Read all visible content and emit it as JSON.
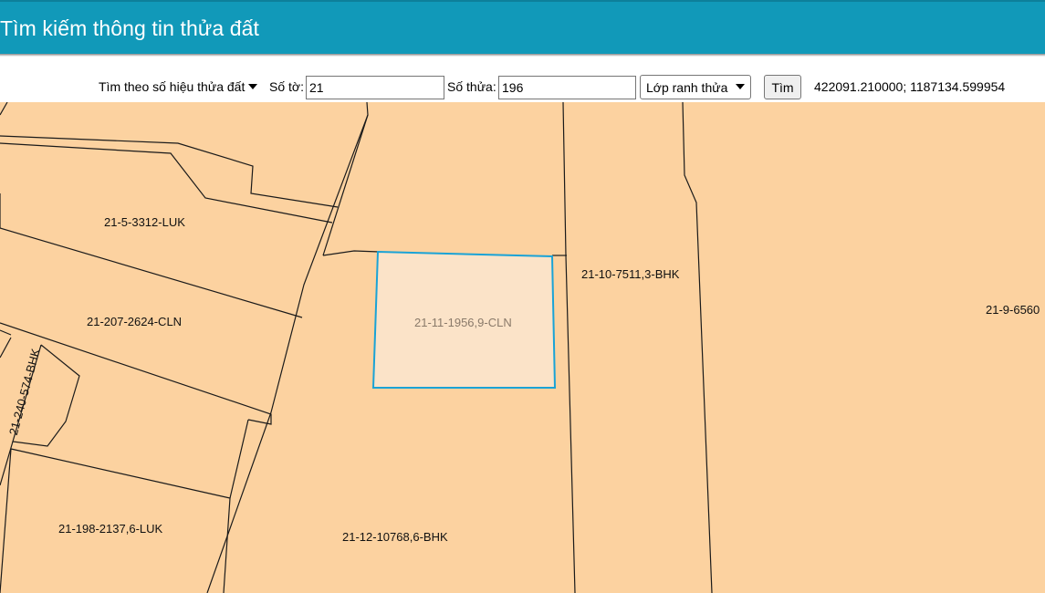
{
  "header": {
    "title": "Tìm kiếm thông tin thửa đất"
  },
  "toolbar": {
    "search_mode": "Tìm theo số hiệu thửa đất",
    "sheet_label": "Số tờ:",
    "sheet_value": "21",
    "parcel_label": "Số thửa:",
    "parcel_value": "196",
    "layer_select": "Lớp ranh thửa",
    "search_button": "Tìm",
    "coordinates": "422091.210000; 1187134.599954"
  },
  "map": {
    "fill_color": "#fcd2a0",
    "highlight_fill": "#fbe3c8",
    "highlight_border": "#1aa3d6",
    "parcels": [
      {
        "id": "p1",
        "label": "21-5-3312-LUK"
      },
      {
        "id": "p2",
        "label": "21-207-2624-CLN"
      },
      {
        "id": "p3",
        "label": "21-240-574-BHK"
      },
      {
        "id": "p4",
        "label": "21-198-2137,6-LUK"
      },
      {
        "id": "p5",
        "label": "21-12-10768,6-BHK"
      },
      {
        "id": "p6",
        "label": "21-11-1956,9-CLN"
      },
      {
        "id": "p7",
        "label": "21-10-7511,3-BHK"
      },
      {
        "id": "p8",
        "label": "21-9-6560"
      }
    ]
  }
}
